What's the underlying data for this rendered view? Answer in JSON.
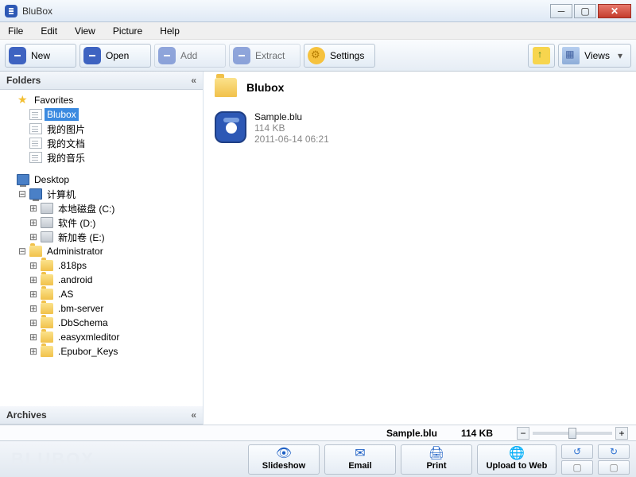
{
  "window": {
    "title": "BluBox"
  },
  "menubar": [
    "File",
    "Edit",
    "View",
    "Picture",
    "Help"
  ],
  "toolbar": {
    "new": "New",
    "open": "Open",
    "add": "Add",
    "extract": "Extract",
    "settings": "Settings",
    "views": "Views"
  },
  "sidebar": {
    "folders_hdr": "Folders",
    "archives_hdr": "Archives",
    "favorites": "Favorites",
    "fav_items": [
      "Blubox",
      "我的图片",
      "我的文档",
      "我的音乐"
    ],
    "desktop": "Desktop",
    "computer": "计算机",
    "drives": [
      "本地磁盘 (C:)",
      "软件 (D:)",
      "新加卷 (E:)"
    ],
    "admin": "Administrator",
    "admin_children": [
      ".818ps",
      ".android",
      ".AS",
      ".bm-server",
      ".DbSchema",
      ".easyxmleditor",
      ".Epubor_Keys"
    ]
  },
  "viewer": {
    "path_title": "Blubox",
    "file": {
      "name": "Sample.blu",
      "size": "114 KB",
      "date": "2011-06-14 06:21"
    }
  },
  "status": {
    "filename": "Sample.blu",
    "size": "114 KB"
  },
  "actions": {
    "brand": "BLUBOX",
    "slideshow": "Slideshow",
    "email": "Email",
    "print": "Print",
    "upload": "Upload to Web"
  }
}
